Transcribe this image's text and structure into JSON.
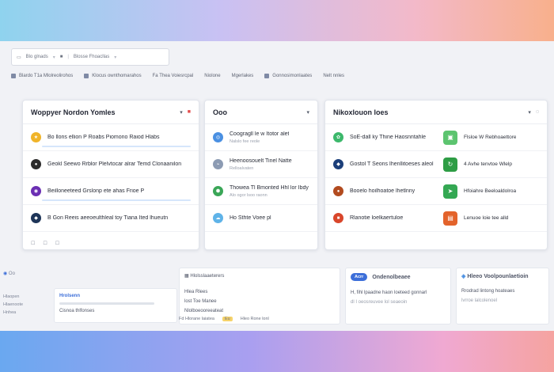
{
  "topbar": {
    "search_left": "Blo glnads",
    "search_right": "Blosse Fhoacllas",
    "dropdown_glyph": "▾"
  },
  "toolbar": {
    "items": [
      "Blardo T1a Mlolreolirohos",
      "Klocus ownthomarahos",
      "Fa Thea Voiesrcpal",
      "Niolone",
      "Mgerlakes",
      "Gonnosimonlaates",
      "Nelt nnles"
    ]
  },
  "panel1": {
    "title": "Woppyer Nordon Yomles",
    "rows": [
      {
        "t1": "Bo llons ellion P Roabs Piomono Raiod Hlabs",
        "t2": "",
        "icon": "#f0b429"
      },
      {
        "t1": "Geokl Seewo Rrblor Plelvtocar alrar Temd Clonaanilon",
        "t2": "",
        "icon": "#2b2b2b"
      },
      {
        "t1": "Beilloneeteed Grslonp ete ahas Frioe P",
        "t2": "",
        "icon": "#6b2fb3"
      },
      {
        "t1": "B Gon Reeis aeeoeulthleal toy Tiana Ited lhueutn",
        "t2": "",
        "icon": "#1e3558"
      }
    ]
  },
  "panel2": {
    "title": "Ooo",
    "rows": [
      {
        "t1": "Coogragll le w Itotor alet",
        "t2": "Nalslo fee reole",
        "icon": "#4a90e2"
      },
      {
        "t1": "Heenoosouelt Tinel Natte",
        "t2": "Relloalvaten",
        "icon": "#8c9bb3"
      },
      {
        "t1": "Thowea Tl Bmonted Hhl lor Ibdy llot",
        "t2": "Alo ogor lsoo raonn",
        "icon": "#3aa657"
      },
      {
        "t1": "Ho Sthte Voee pl",
        "t2": "",
        "icon": "#5fb3e8"
      }
    ]
  },
  "panel3": {
    "title": "Nikoxlouon loes",
    "rows": [
      {
        "t1": "SoE-dall ky Thine Haosnntahle",
        "t2": "",
        "icon": "#3cb86b",
        "side": "Flsloe W Rebhoaettore",
        "sicon": "#5cc46f"
      },
      {
        "t1": "Gostol T Seons Ihenllitoeses aleol",
        "t2": "",
        "icon": "#1c3f7a",
        "side": "4 Avhe tenvtoe Wlelp",
        "sicon": "#2e9d45"
      },
      {
        "t1": "Booelo hoilhoatoe lhetlnny",
        "t2": "",
        "icon": "#b24b1f",
        "side": "Hfoiahre Beeloaldolroa",
        "sicon": "#34a853"
      },
      {
        "t1": "Rlanotie loelkaertuloe",
        "t2": "",
        "icon": "#d9462b",
        "side": "Lenuoe loie tee alld",
        "sicon": "#e3632b"
      }
    ]
  },
  "lower": {
    "left_label": "Oo",
    "box1": [
      "Hrolsenn",
      "Cisnoa thlfonses"
    ],
    "box2": [
      "Hlolsslaaeterers",
      "Hlea Rlees",
      "lost Toe Manee",
      "Nlolboeooreeateat"
    ],
    "box3_btn": "Acrr",
    "box3_title": "Ondenolbeaee",
    "box3_lines": [
      "H, fihl lpaadne haon loeteed gonnarl",
      "dl I oeosreuvee lol seaeoin"
    ],
    "box4_title": "Hleeo Voolpounlaetioin",
    "box4_lines": [
      "Rrodrad lintong hoateaes",
      "lvrroe lalcolenoel"
    ],
    "foot_tags": [
      "Fd Hlorane laiatea",
      "Eu",
      "Hleo Rone lonl"
    ]
  },
  "side_left": [
    "Hlaopen",
    "Hlaenoote",
    "Hnhea"
  ]
}
